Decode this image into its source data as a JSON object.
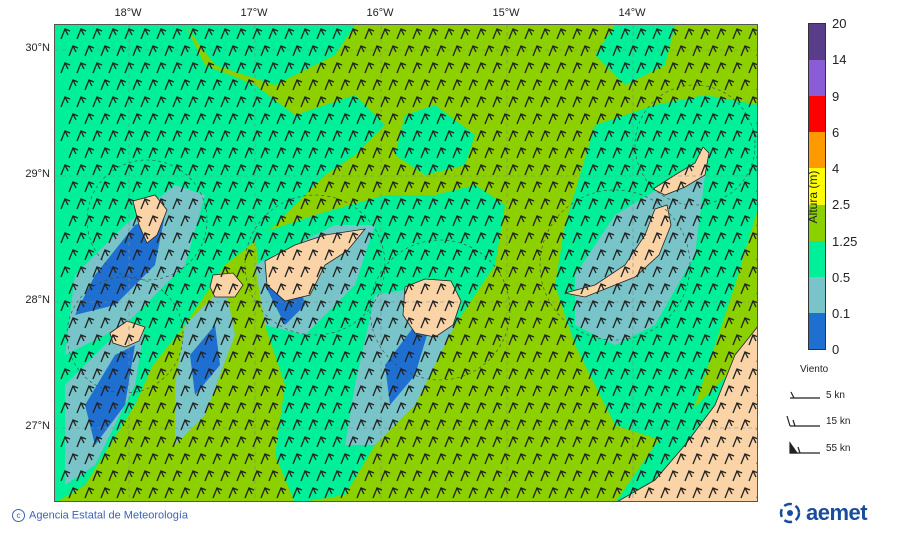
{
  "map": {
    "colors": {
      "sea_deep": "#8cd000",
      "band_125": "#00f09a",
      "band_05": "#78c4c8",
      "band_01": "#1f6fd0",
      "land": "#fad4a6",
      "grid": "#888888",
      "barb": "#222222"
    },
    "lon_labels": [
      "18°W",
      "17°W",
      "16°W",
      "15°W",
      "14°W"
    ],
    "lat_labels": [
      "30°N",
      "29°N",
      "28°N",
      "27°N"
    ]
  },
  "colorbar": {
    "title": "Altura (m)",
    "ticks": [
      "0",
      "0.1",
      "0.5",
      "1.25",
      "2.5",
      "4",
      "6",
      "9",
      "14",
      "20"
    ],
    "colors": [
      "#1f6fd0",
      "#78c4c8",
      "#00f09a",
      "#8cd000",
      "#ffff00",
      "#ff9900",
      "#ff0000",
      "#8a5cd6",
      "#5a3d8a"
    ]
  },
  "legend": {
    "title": "Viento",
    "items": [
      {
        "label": "5 kn",
        "icon": "wind-barb-5"
      },
      {
        "label": "15 kn",
        "icon": "wind-barb-15"
      },
      {
        "label": "55 kn",
        "icon": "wind-barb-55"
      }
    ]
  },
  "footer": {
    "credit": "Agencia Estatal de Meteorología",
    "logo_text": "aemet",
    "logo_icon": "aemet-logo-icon"
  }
}
